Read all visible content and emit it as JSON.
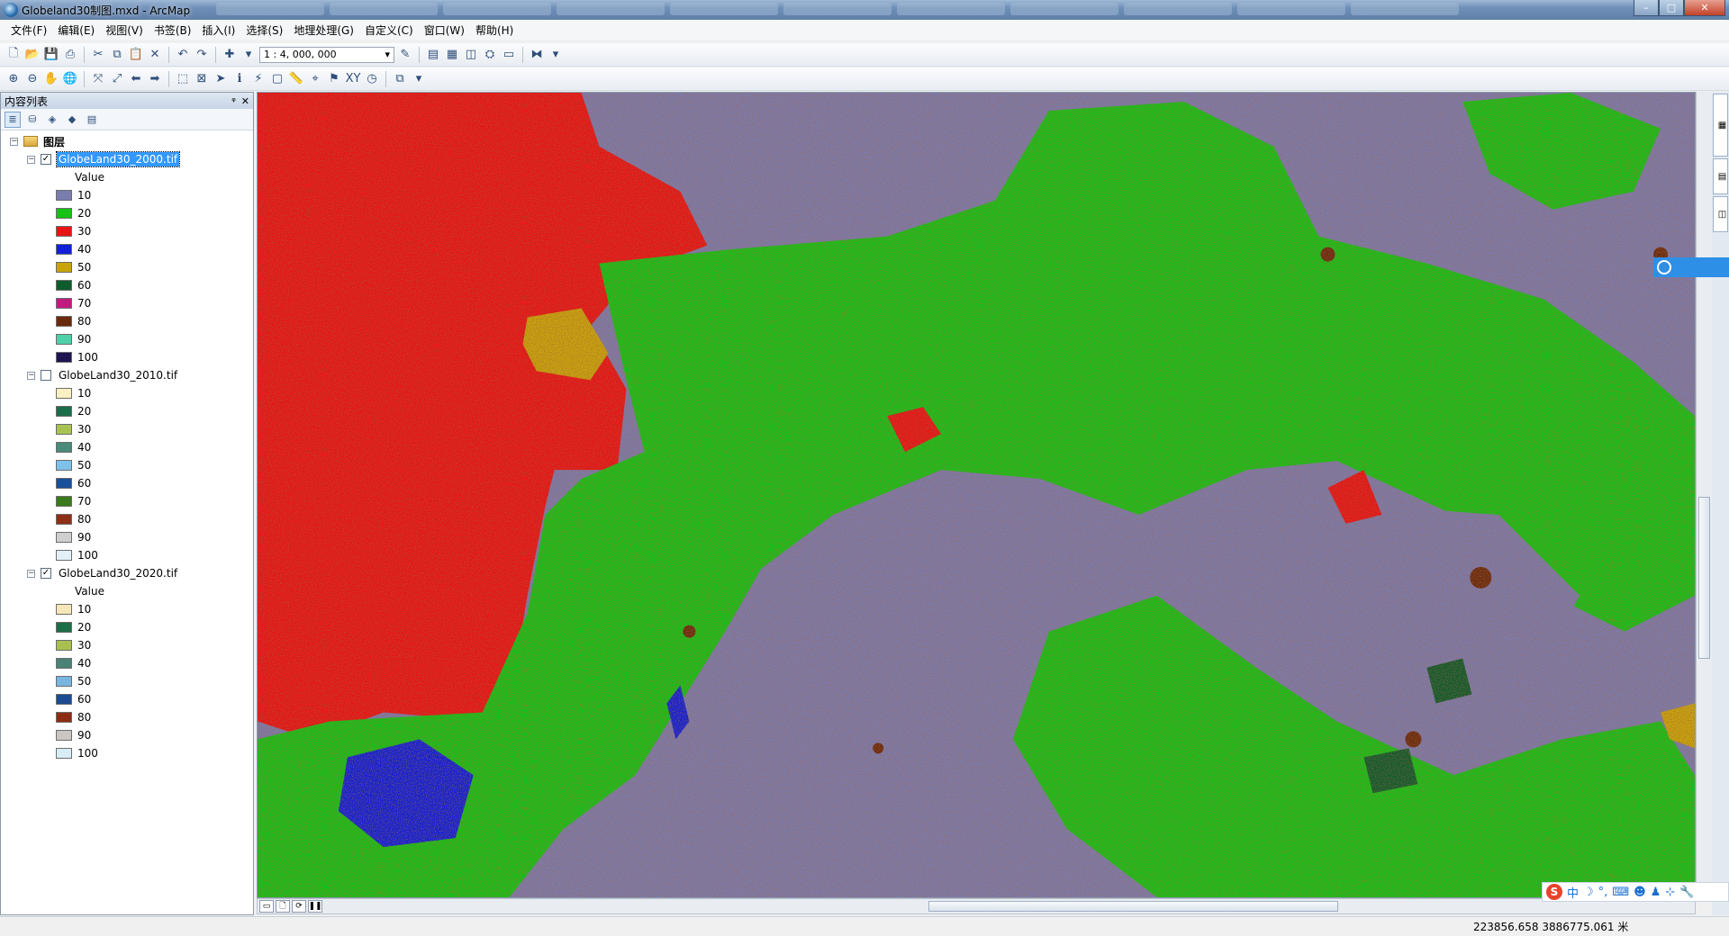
{
  "window": {
    "title": "Globeland30制图.mxd - ArcMap",
    "minimize": "–",
    "maximize": "□",
    "close": "✕"
  },
  "menu": [
    "文件(F)",
    "编辑(E)",
    "视图(V)",
    "书签(B)",
    "插入(I)",
    "选择(S)",
    "地理处理(G)",
    "自定义(C)",
    "窗口(W)",
    "帮助(H)"
  ],
  "toolbar": {
    "scale": "1 : 4, 000, 000"
  },
  "toc": {
    "title": "内容列表",
    "pin": "ᵠ",
    "close": "✕",
    "root_label": "图层",
    "layers": [
      {
        "name": "GlobeLand30_2000.tif",
        "checked": true,
        "selected": true,
        "value_header": "Value",
        "classes": [
          {
            "label": "10",
            "color": "#7b7cae"
          },
          {
            "label": "20",
            "color": "#15c315"
          },
          {
            "label": "30",
            "color": "#e81414"
          },
          {
            "label": "40",
            "color": "#1020d8"
          },
          {
            "label": "50",
            "color": "#c9a40a"
          },
          {
            "label": "60",
            "color": "#0e5c2c"
          },
          {
            "label": "70",
            "color": "#c21b80"
          },
          {
            "label": "80",
            "color": "#6a2a0c"
          },
          {
            "label": "90",
            "color": "#4fd0a8"
          },
          {
            "label": "100",
            "color": "#1e1452"
          }
        ]
      },
      {
        "name": "GlobeLand30_2010.tif",
        "checked": false,
        "selected": false,
        "value_header": "",
        "classes": [
          {
            "label": "10",
            "color": "#fbf0c2"
          },
          {
            "label": "20",
            "color": "#1c6d4a"
          },
          {
            "label": "30",
            "color": "#a9c353"
          },
          {
            "label": "40",
            "color": "#4a8a78"
          },
          {
            "label": "50",
            "color": "#7cc2ea"
          },
          {
            "label": "60",
            "color": "#1a4f9a"
          },
          {
            "label": "70",
            "color": "#3a7a1a"
          },
          {
            "label": "80",
            "color": "#8e2e14"
          },
          {
            "label": "90",
            "color": "#cfcfcf"
          },
          {
            "label": "100",
            "color": "#e2f1f8"
          }
        ]
      },
      {
        "name": "GlobeLand30_2020.tif",
        "checked": true,
        "selected": false,
        "value_header": "Value",
        "classes": [
          {
            "label": "10",
            "color": "#f6e7b8"
          },
          {
            "label": "20",
            "color": "#1f6c48"
          },
          {
            "label": "30",
            "color": "#a8c050"
          },
          {
            "label": "40",
            "color": "#4a8276"
          },
          {
            "label": "50",
            "color": "#77b6de"
          },
          {
            "label": "60",
            "color": "#1b4c92"
          },
          {
            "label": "80",
            "color": "#8c2c12"
          },
          {
            "label": "90",
            "color": "#c9c6c4"
          },
          {
            "label": "100",
            "color": "#d7ecf7"
          }
        ]
      }
    ]
  },
  "map": {
    "colors": {
      "cropland": "#7b7cae",
      "forest": "#15c315",
      "grassland": "#e81414",
      "shrub": "#c9a40a",
      "wetland": "#0e5c2c",
      "artificial": "#6a2a0c",
      "water": "#1020d8"
    }
  },
  "status": {
    "coordinates": "223856.658  3886775.061 米"
  },
  "ime": {
    "logo": "S",
    "mode": "中"
  }
}
